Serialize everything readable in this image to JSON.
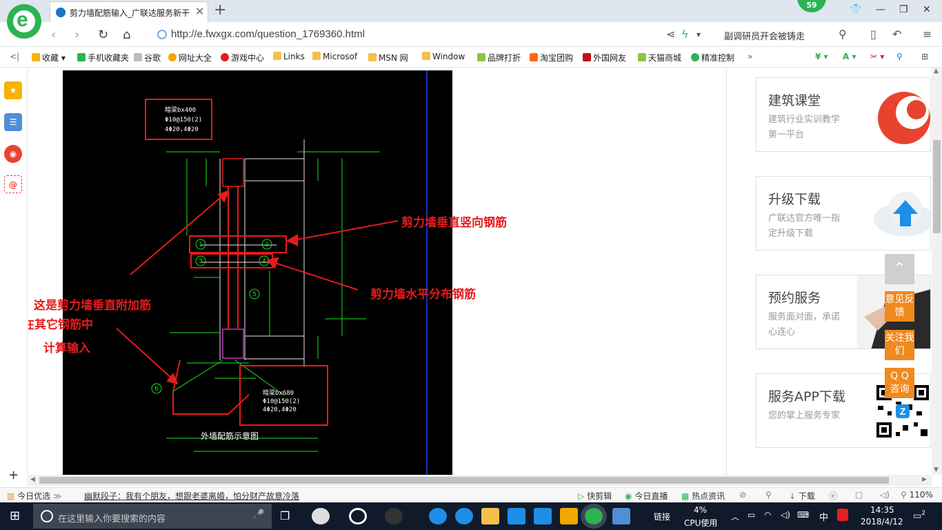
{
  "browser": {
    "tab_title": "剪力墙配筋输入_广联达服务新干",
    "badge_count": "59",
    "url": "http://e.fwxgx.com/question_1769360.html",
    "hot_search": "副调研员开会被铸走"
  },
  "bookmarks": [
    {
      "label": "收藏",
      "color": "#f5b400"
    },
    {
      "label": "手机收藏夹",
      "color": "#2cb352"
    },
    {
      "label": "谷歌",
      "color": "#999999"
    },
    {
      "label": "网址大全",
      "color": "#f0a800"
    },
    {
      "label": "游戏中心",
      "color": "#e02020"
    },
    {
      "label": "Links",
      "color": "#f3c14b"
    },
    {
      "label": "Microsof",
      "color": "#f3c14b"
    },
    {
      "label": "MSN 网",
      "color": "#f3c14b"
    },
    {
      "label": "Window",
      "color": "#f3c14b"
    },
    {
      "label": "品牌打折",
      "color": "#8cc63f"
    },
    {
      "label": "淘宝团购",
      "color": "#ff6a00"
    },
    {
      "label": "外国网友",
      "color": "#c01010"
    },
    {
      "label": "天猫商城",
      "color": "#8cc63f"
    },
    {
      "label": "精准控制",
      "color": "#2cb352"
    }
  ],
  "figure": {
    "top_box": [
      "暗梁bx400",
      "Φ10@150(2)",
      "4Φ20,4Φ20"
    ],
    "bottom_box": [
      "暗梁bx680",
      "Φ10@150(2)",
      "4Φ20,4Φ20"
    ],
    "caption": "外墙配筋示意图",
    "circles": [
      "1",
      "2",
      "3",
      "4",
      "5",
      "6"
    ],
    "annotation_vertical": "剪力墙垂直竖向钢筋",
    "annotation_horizontal": "剪力墙水平分布钢筋",
    "annotation_additional_1": "这是剪力墙垂直附加筋",
    "annotation_additional_2": "在其它钢筋中",
    "annotation_additional_3": "计算输入"
  },
  "cards": [
    {
      "title": "建筑课堂",
      "desc": "建筑行业实训教学第一平台"
    },
    {
      "title": "升级下载",
      "desc": "广联达官方唯一指定升级下载"
    },
    {
      "title": "预约服务",
      "desc": "服务面对面，承诺心连心"
    },
    {
      "title": "服务APP下载",
      "desc": "您的掌上服务专家"
    }
  ],
  "float_buttons": {
    "feedback": "意见反馈",
    "follow": "关注我们",
    "qq": "Q Q 咨询"
  },
  "statusbar": {
    "today": "今日优选",
    "news": "幽默段子：我有个朋友，想跟老婆离婚，怕分财产故意冷落",
    "clip": "快剪辑",
    "live": "今日直播",
    "hotnews": "热点资讯",
    "download": "下载",
    "zoom": "110%"
  },
  "taskbar": {
    "search_placeholder": "在这里输入你要搜索的内容",
    "link": "链接",
    "cpu_percent": "4%",
    "cpu_label": "CPU使用",
    "ime": "中",
    "time": "14:35",
    "date": "2018/4/12",
    "notifications": "2"
  },
  "colors": {
    "brand_green": "#2cb352",
    "annotation_red": "#e61b1b",
    "cad_green": "#19e619",
    "float_orange": "#f08a1e"
  }
}
